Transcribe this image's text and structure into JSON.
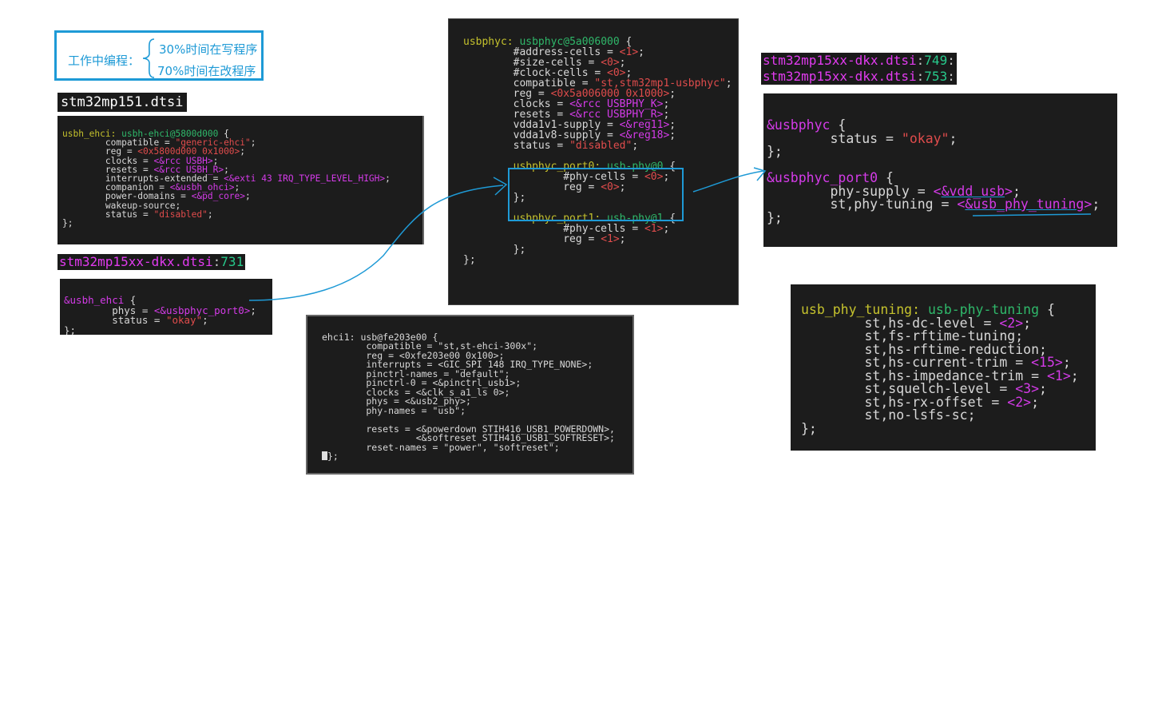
{
  "note": {
    "lead": "工作中编程：",
    "item1": "30%时间在写程序",
    "item2": "70%时间在改程序"
  },
  "labels": {
    "stm32mp151": "stm32mp151.dtsi",
    "dkx731": {
      "file": "stm32mp15xx-dkx.dtsi",
      "sep": ":",
      "line": "731"
    },
    "dkx749": {
      "file": "stm32mp15xx-dkx.dtsi",
      "sep": ":",
      "line": "749",
      "colon": ":"
    },
    "dkx753": {
      "file": "stm32mp15xx-dkx.dtsi",
      "sep": ":",
      "line": "753",
      "colon": ":"
    }
  },
  "box1": {
    "l1_label": "usbh_ehci:",
    "l1_node": "usbh-ehci@5800d000",
    "l1_brace": " {",
    "l2_key": "        compatible = ",
    "l2_val": "\"generic-ehci\"",
    "l2_end": ";",
    "l3_key": "        reg = ",
    "l3_val": "<0x5800d000 0x1000>",
    "l3_end": ";",
    "l4_key": "        clocks = ",
    "l4_val": "<&rcc USBH>",
    "l4_end": ";",
    "l5_key": "        resets = ",
    "l5_val": "<&rcc USBH_R>",
    "l5_end": ";",
    "l6_key": "        interrupts-extended = ",
    "l6_val": "<&exti 43 IRQ_TYPE_LEVEL_HIGH>",
    "l6_end": ";",
    "l7_key": "        companion = ",
    "l7_val": "<&usbh_ohci>",
    "l7_end": ";",
    "l8_key": "        power-domains = ",
    "l8_val": "<&pd_core>",
    "l8_end": ";",
    "l9": "        wakeup-source;",
    "l10_key": "        status = ",
    "l10_val": "\"disabled\"",
    "l10_end": ";",
    "l11": "};"
  },
  "box2": {
    "l1_ref": "&usbh_ehci",
    "l1_brace": " {",
    "l2_key": "        phys = ",
    "l2_val": "<&usbphyc_port0>",
    "l2_end": ";",
    "l3_key": "        status = ",
    "l3_val": "\"okay\"",
    "l3_end": ";",
    "l4": "};"
  },
  "box3": {
    "l1_label": "usbphyc:",
    "l1_node": "usbphyc@5a006000",
    "l1_brace": " {",
    "l2_key": "        #address-cells = ",
    "l2_val": "<1>",
    "l2_end": ";",
    "l3_key": "        #size-cells = ",
    "l3_val": "<0>",
    "l3_end": ";",
    "l4_key": "        #clock-cells = ",
    "l4_val": "<0>",
    "l4_end": ";",
    "l5_key": "        compatible = ",
    "l5_val": "\"st,stm32mp1-usbphyc\"",
    "l5_end": ";",
    "l6_key": "        reg = ",
    "l6_val": "<0x5a006000 0x1000>",
    "l6_end": ";",
    "l7_key": "        clocks = ",
    "l7_val": "<&rcc USBPHY_K>",
    "l7_end": ";",
    "l8_key": "        resets = ",
    "l8_val": "<&rcc USBPHY_R>",
    "l8_end": ";",
    "l9_key": "        vdda1v1-supply = ",
    "l9_val": "<&reg11>",
    "l9_end": ";",
    "l10_key": "        vdda1v8-supply = ",
    "l10_val": "<&reg18>",
    "l10_end": ";",
    "l11_key": "        status = ",
    "l11_val": "\"disabled\"",
    "l11_end": ";",
    "p0_label": "        usbphyc_port0:",
    "p0_node": " usb-phy@0",
    "p0_brace": " {",
    "p0_l2_key": "                #phy-cells = ",
    "p0_l2_val": "<0>",
    "p0_l2_end": ";",
    "p0_l3_key": "                reg = ",
    "p0_l3_val": "<0>",
    "p0_l3_end": ";",
    "p0_l4": "        };",
    "p1_label": "        usbphyc_port1:",
    "p1_node": " usb-phy@1",
    "p1_brace": " {",
    "p1_l2_key": "                #phy-cells = ",
    "p1_l2_val": "<1>",
    "p1_l2_end": ";",
    "p1_l3_key": "                reg = ",
    "p1_l3_val": "<1>",
    "p1_l3_end": ";",
    "p1_l4": "        };",
    "end": "};"
  },
  "box4": {
    "l1": "ehci1: usb@fe203e00 {",
    "l2": "        compatible = \"st,st-ehci-300x\";",
    "l3": "        reg = <0xfe203e00 0x100>;",
    "l4": "        interrupts = <GIC_SPI 148 IRQ_TYPE_NONE>;",
    "l5": "        pinctrl-names = \"default\";",
    "l6": "        pinctrl-0 = <&pinctrl_usb1>;",
    "l7": "        clocks = <&clk_s_a1_ls 0>;",
    "l8": "        phys = <&usb2_phy>;",
    "l9": "        phy-names = \"usb\";",
    "l11": "        resets = <&powerdown STIH416_USB1_POWERDOWN>,",
    "l12": "                 <&softreset STIH416_USB1_SOFTRESET>;",
    "l13": "        reset-names = \"power\", \"softreset\";",
    "l14": "};"
  },
  "box5": {
    "l1_ref": "&usbphyc",
    "l1_brace": " {",
    "l2_key": "        status = ",
    "l2_val": "\"okay\"",
    "l2_end": ";",
    "l3": "};",
    "l5_ref": "&usbphyc_port0",
    "l5_brace": " {",
    "l6_key": "        phy-supply = ",
    "l6_open": "<",
    "l6_ref": "&vdd_usb",
    "l6_close": ">",
    "l6_end": ";",
    "l7_key": "        st,phy-tuning = ",
    "l7_open": "<",
    "l7_ref": "&usb_phy_tuning",
    "l7_close": ">",
    "l7_end": ";",
    "l8": "};"
  },
  "box6": {
    "l1_label": "usb_phy_tuning:",
    "l1_node": " usb-phy-tuning",
    "l1_brace": " {",
    "l2_key": "        st,hs-dc-level = ",
    "l2_val": "<2>",
    "l2_end": ";",
    "l3": "        st,fs-rftime-tuning;",
    "l4": "        st,hs-rftime-reduction;",
    "l5_key": "        st,hs-current-trim = ",
    "l5_val": "<15>",
    "l5_end": ";",
    "l6_key": "        st,hs-impedance-trim = ",
    "l6_val": "<1>",
    "l6_end": ";",
    "l7_key": "        st,squelch-level = ",
    "l7_val": "<3>",
    "l7_end": ";",
    "l8_key": "        st,hs-rx-offset = ",
    "l8_val": "<2>",
    "l8_end": ";",
    "l9": "        st,no-lsfs-sc;",
    "l10": "};"
  }
}
